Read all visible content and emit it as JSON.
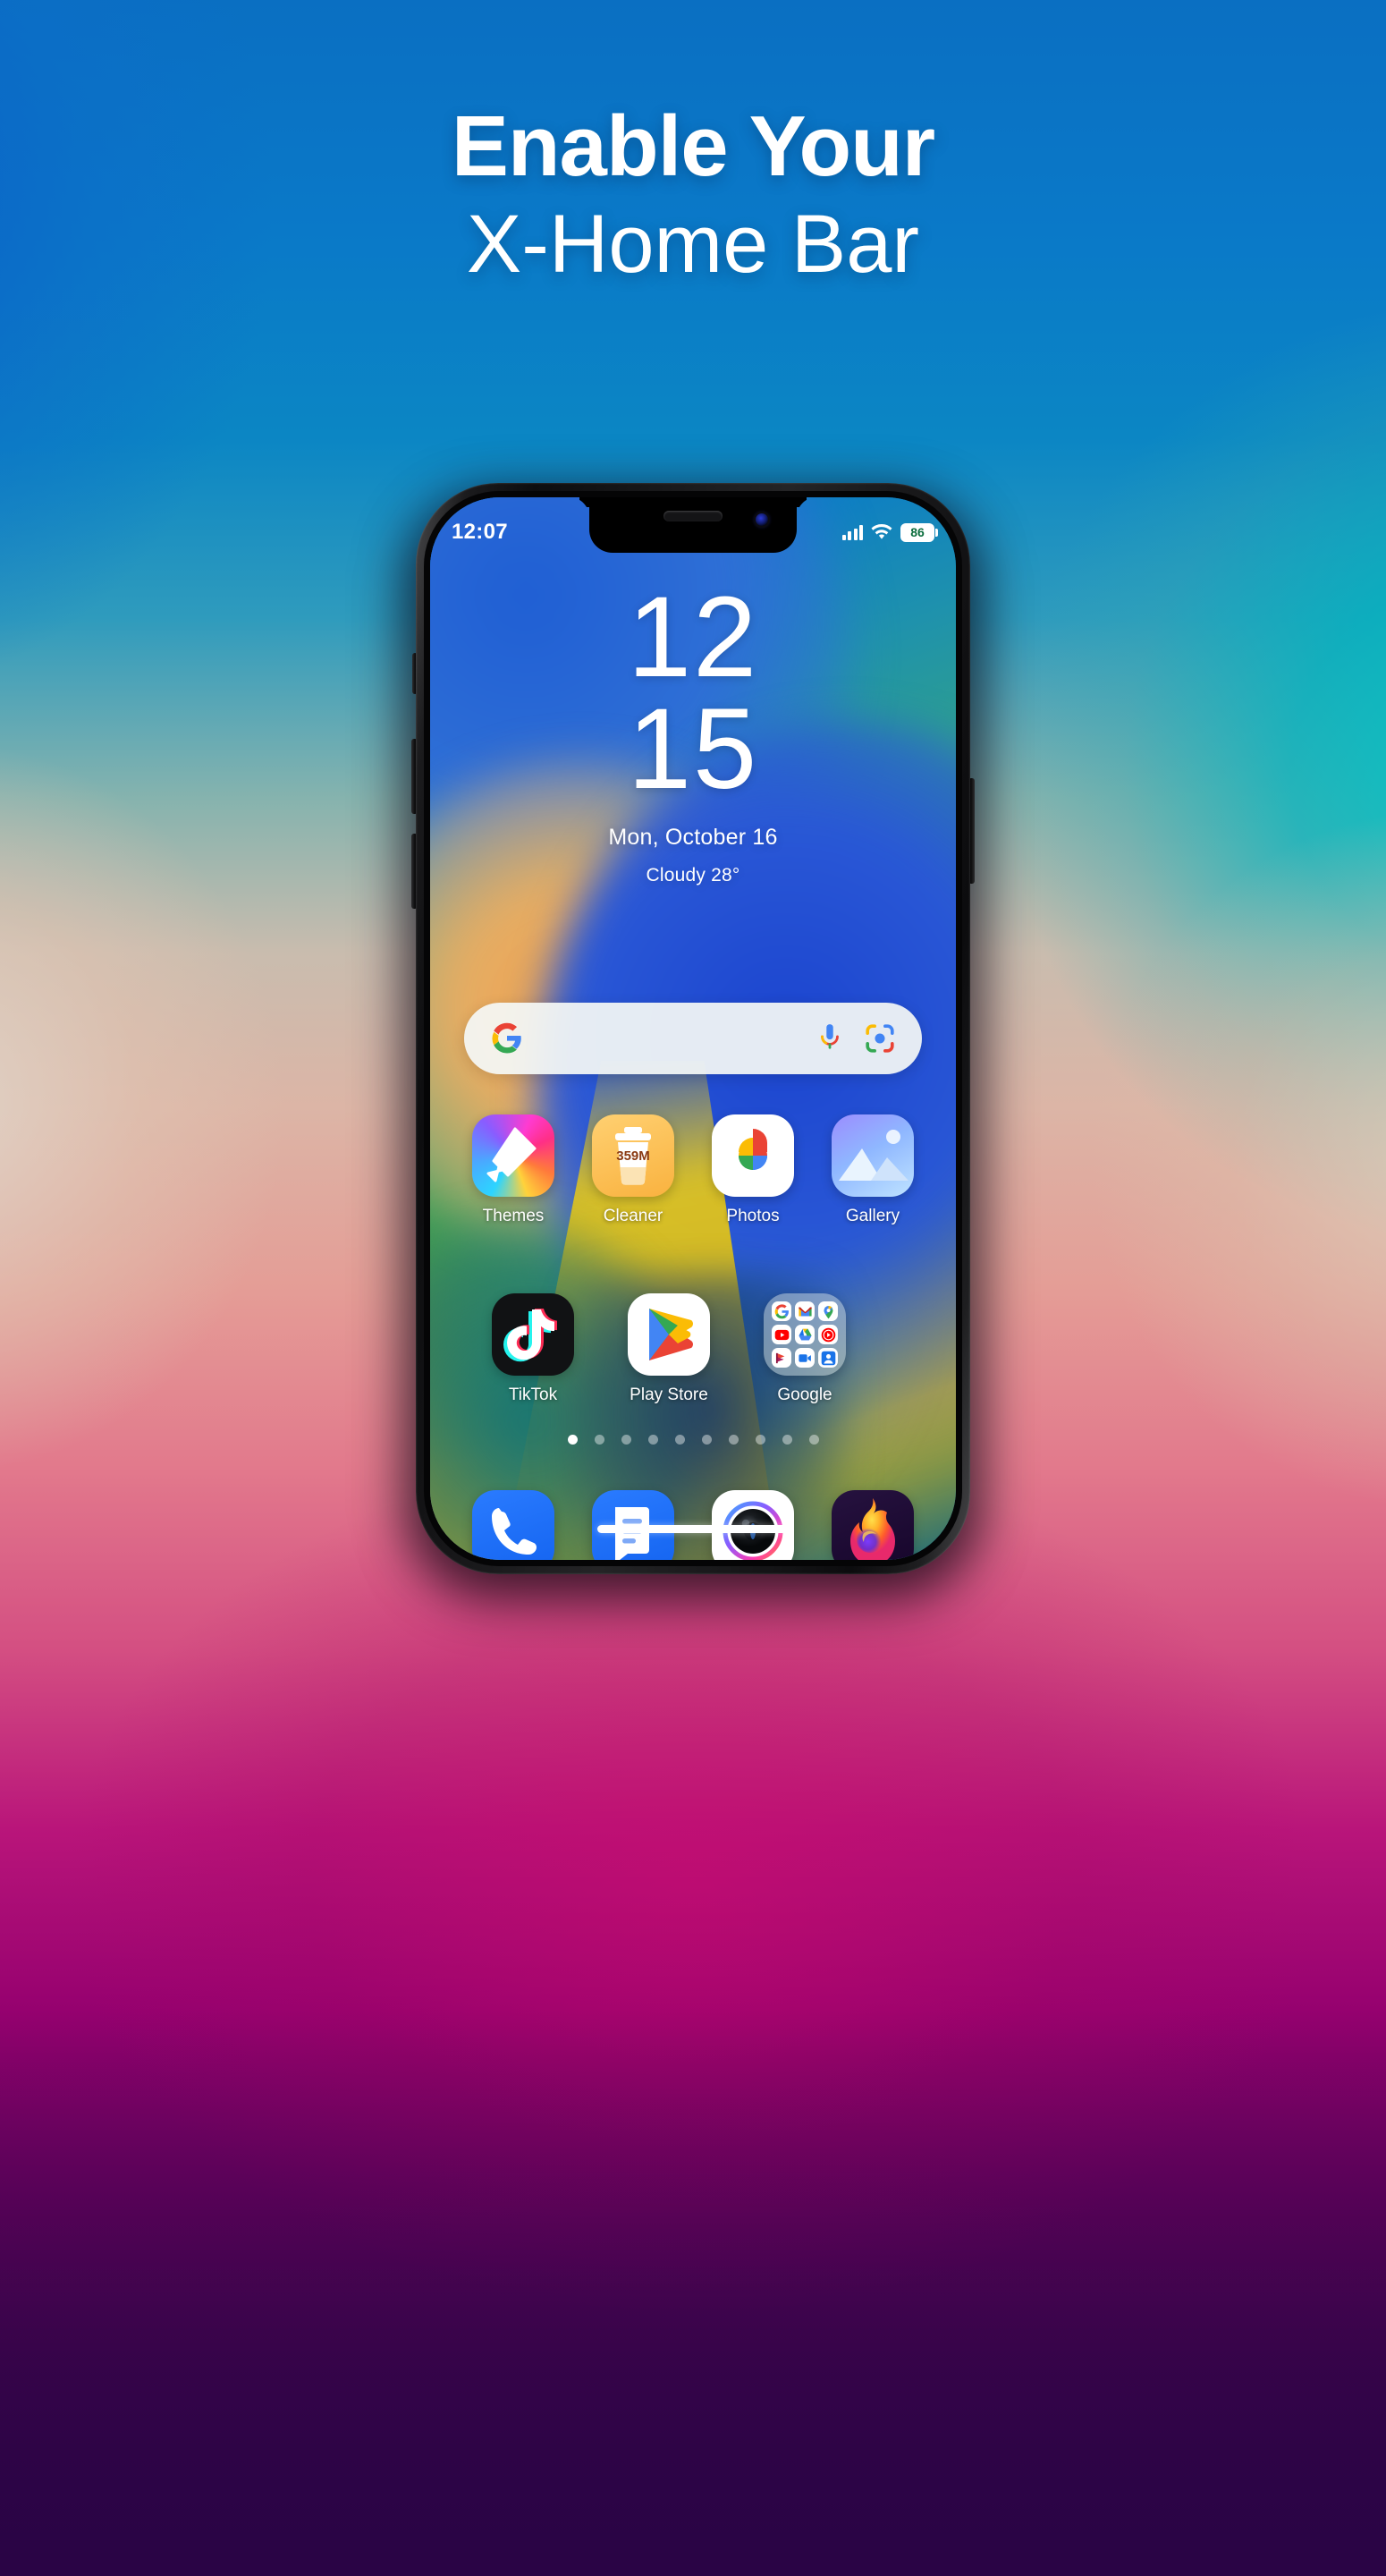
{
  "promo": {
    "headline_line1": "Enable Your",
    "headline_line2": "X-Home Bar",
    "bg_top_color": "#0872c4",
    "bg_mid_color": "#e2798c",
    "bg_bottom_color": "#2a0445"
  },
  "phone": {
    "statusbar": {
      "time": "12:07",
      "battery_level": "86",
      "signal_icon": "cellular-signal-icon",
      "wifi_icon": "wifi-icon",
      "battery_icon": "battery-icon"
    },
    "clock_widget": {
      "hours": "12",
      "minutes": "15",
      "date": "Mon, October 16",
      "weather": "Cloudy  28°"
    },
    "search": {
      "placeholder": "",
      "value": "",
      "google_icon": "google-g-icon",
      "mic_icon": "microphone-icon",
      "lens_icon": "google-lens-icon"
    },
    "app_rows": [
      [
        {
          "label": "Themes",
          "icon": "themes-icon"
        },
        {
          "label": "Cleaner",
          "icon": "cleaner-icon",
          "badge": "359M"
        },
        {
          "label": "Photos",
          "icon": "google-photos-icon"
        },
        {
          "label": "Gallery",
          "icon": "gallery-icon"
        }
      ],
      [
        {
          "label": "TikTok",
          "icon": "tiktok-icon"
        },
        {
          "label": "Play Store",
          "icon": "google-play-icon"
        },
        {
          "label": "Google",
          "icon": "google-folder-icon",
          "folder_apps": [
            "Google",
            "Gmail",
            "Maps",
            "YouTube",
            "Drive",
            "YT Music",
            "Photos",
            "Meet",
            "Contacts"
          ]
        }
      ]
    ],
    "dock": [
      {
        "label": "",
        "icon": "phone-icon"
      },
      {
        "label": "",
        "icon": "messages-icon"
      },
      {
        "label": "",
        "icon": "camera-icon"
      },
      {
        "label": "",
        "icon": "firefox-icon"
      }
    ],
    "page_dots": {
      "count": 10,
      "active_index": 0
    },
    "home_bar": {
      "name": "x-home-bar",
      "color": "#ffffff"
    }
  }
}
